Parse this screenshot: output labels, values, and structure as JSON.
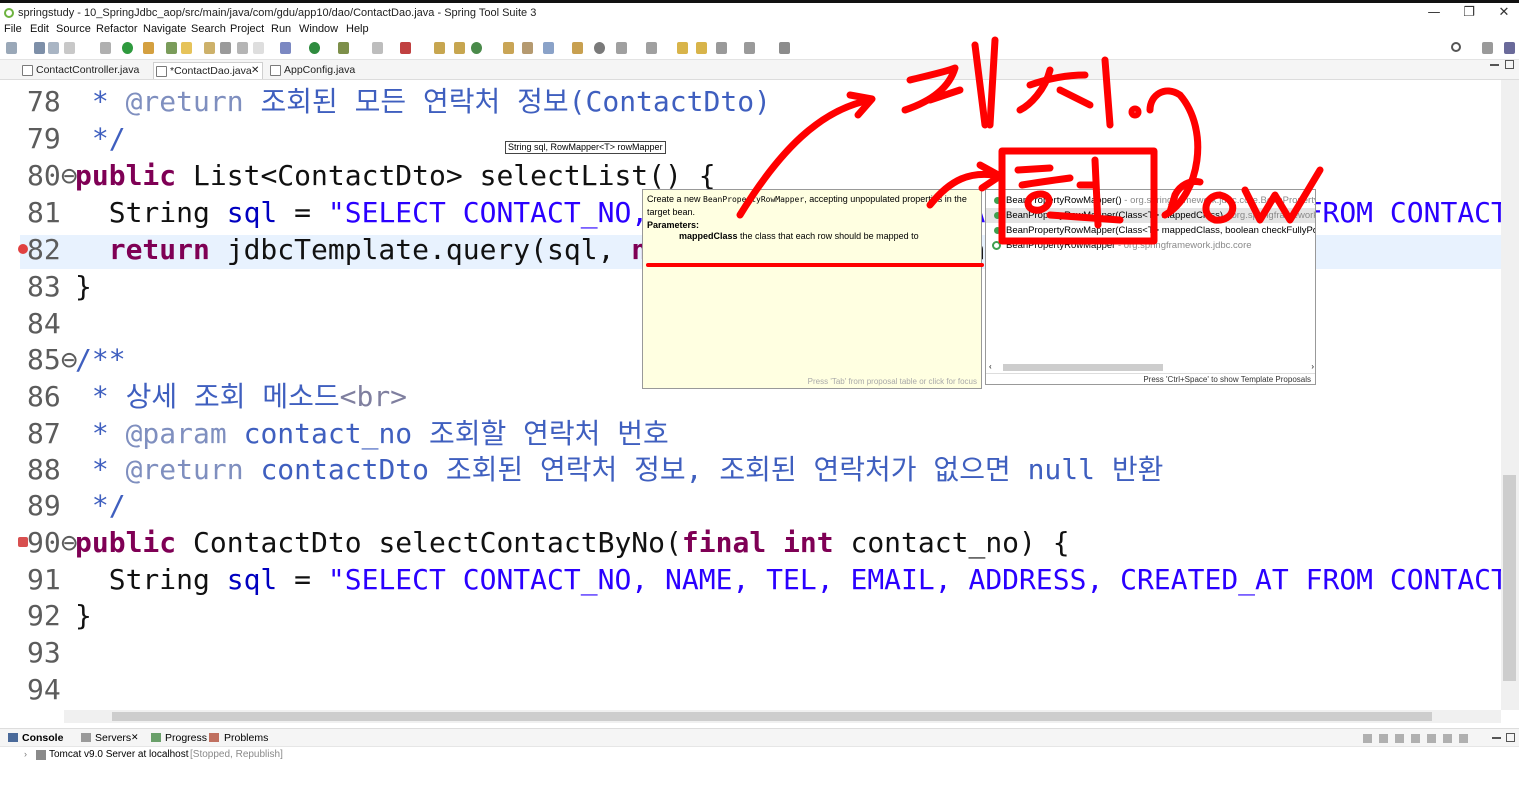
{
  "window": {
    "title": "springstudy - 10_SpringJdbc_aop/src/main/java/com/gdu/app10/dao/ContactDao.java - Spring Tool Suite 3",
    "minimize": "—",
    "maximize": "❐",
    "close": "✕"
  },
  "menu": [
    "File",
    "Edit",
    "Source",
    "Refactor",
    "Navigate",
    "Search",
    "Project",
    "Run",
    "Window",
    "Help"
  ],
  "tabs": [
    {
      "label": "ContactController.java",
      "active": false
    },
    {
      "label": "*ContactDao.java",
      "active": true,
      "close": "✕"
    },
    {
      "label": "AppConfig.java",
      "active": false
    }
  ],
  "editor": {
    "lines": [
      {
        "num": "78",
        "tokens": [
          {
            "c": "cm",
            "t": " * "
          },
          {
            "c": "ann",
            "t": "@return"
          },
          {
            "c": "cm",
            "t": " 조회된 모든 연락처 정보(ContactDto)"
          }
        ]
      },
      {
        "num": "79",
        "tokens": [
          {
            "c": "cm",
            "t": " */"
          }
        ]
      },
      {
        "num": "80⊖",
        "tokens": [
          {
            "c": "kw",
            "t": "public"
          },
          {
            "c": "txt",
            "t": " List<ContactDto> selectList() {"
          }
        ]
      },
      {
        "num": "81",
        "tokens": [
          {
            "c": "txt",
            "t": "  String "
          },
          {
            "c": "fld",
            "t": "sql"
          },
          {
            "c": "txt",
            "t": " = "
          },
          {
            "c": "str",
            "t": "\"SELECT CONTACT_NO, NAME, TEL, EMAIL, ADDRESS, CREATED_AT FROM CONTACT_T ORDER BY CONTACT_NO DESC\";"
          }
        ]
      },
      {
        "num": "82",
        "tokens": [
          {
            "c": "kw",
            "t": "  return"
          },
          {
            "c": "txt",
            "t": " jdbcTemplate.query(sql, "
          },
          {
            "c": "kw",
            "t": "new"
          },
          {
            "c": "txt",
            "t": " BeanPropertyRowMapper)"
          }
        ]
      },
      {
        "num": "83",
        "tokens": [
          {
            "c": "txt",
            "t": "}"
          }
        ]
      },
      {
        "num": "84",
        "tokens": []
      },
      {
        "num": "85⊖",
        "tokens": [
          {
            "c": "cm",
            "t": "/**"
          }
        ]
      },
      {
        "num": "86",
        "tokens": [
          {
            "c": "cm",
            "t": " * 상세 조회 메소드"
          },
          {
            "c": "tag",
            "t": "<br>"
          }
        ]
      },
      {
        "num": "87",
        "tokens": [
          {
            "c": "cm",
            "t": " * "
          },
          {
            "c": "ann",
            "t": "@param"
          },
          {
            "c": "cm",
            "t": " contact_no 조회할 연락처 번호"
          }
        ]
      },
      {
        "num": "88",
        "tokens": [
          {
            "c": "cm",
            "t": " * "
          },
          {
            "c": "ann",
            "t": "@return"
          },
          {
            "c": "cm",
            "t": " contactDto 조회된 연락처 정보, 조회된 연락처가 없으면 null 반환"
          }
        ]
      },
      {
        "num": "89",
        "tokens": [
          {
            "c": "cm",
            "t": " */"
          }
        ]
      },
      {
        "num": "90⊖",
        "tokens": [
          {
            "c": "kw",
            "t": "public"
          },
          {
            "c": "txt",
            "t": " ContactDto selectContactByNo("
          },
          {
            "c": "kw",
            "t": "final int"
          },
          {
            "c": "txt",
            "t": " contact_no) {"
          }
        ]
      },
      {
        "num": "91",
        "tokens": [
          {
            "c": "txt",
            "t": "  String "
          },
          {
            "c": "fld",
            "t": "sql"
          },
          {
            "c": "txt",
            "t": " = "
          },
          {
            "c": "str",
            "t": "\"SELECT CONTACT_NO, NAME, TEL, EMAIL, ADDRESS, CREATED_AT FROM CONTACT_T WHERE CONTACT_NO = ?\";"
          }
        ]
      },
      {
        "num": "92",
        "tokens": [
          {
            "c": "txt",
            "t": "}"
          }
        ]
      },
      {
        "num": "93",
        "tokens": []
      },
      {
        "num": "94",
        "tokens": []
      }
    ]
  },
  "param_hint": "String sql, RowMapper<T> rowMapper",
  "javadoc": {
    "intro_a": "Create a new",
    "intro_code": "BeanPropertyRowMapper",
    "intro_b": ", accepting unpopulated properties in the target bean.",
    "params_heading": "Parameters:",
    "param_name": "mappedClass",
    "param_desc": "the class that each row should be mapped to",
    "status": "Press 'Tab' from proposal table or click for focus"
  },
  "proposals": [
    {
      "name": "BeanPropertyRowMapper()",
      "qual": " - org.springframework.jdbc.core.BeanPropertyRowMapper",
      "icon": "dot",
      "selected": false
    },
    {
      "name": "BeanPropertyRowMapper(Class<T> mappedClass)",
      "qual": " - org.springframework.jdbc.core",
      "icon": "dot",
      "selected": true
    },
    {
      "name": "BeanPropertyRowMapper(Class<T> mappedClass, boolean checkFullyPopulated)",
      "qual": "",
      "icon": "dot",
      "selected": false
    },
    {
      "name": "BeanPropertyRowMapper",
      "qual": " - org.springframework.jdbc.core",
      "icon": "ring",
      "selected": false
    }
  ],
  "proposal_status": "Press 'Ctrl+Space' to show Template Proposals",
  "bottom": {
    "tabs": [
      "Console",
      "Servers",
      "Progress",
      "Problems"
    ],
    "server": "Tomcat v9.0 Server at localhost",
    "server_state": "[Stopped, Republish]"
  },
  "handwriting": [
    "객체.",
    "행",
    "row"
  ],
  "colors": {
    "annotation_red": "#ff0000",
    "keyword": "#7f0055",
    "string": "#2a00ff",
    "comment": "#3f5fbf"
  }
}
